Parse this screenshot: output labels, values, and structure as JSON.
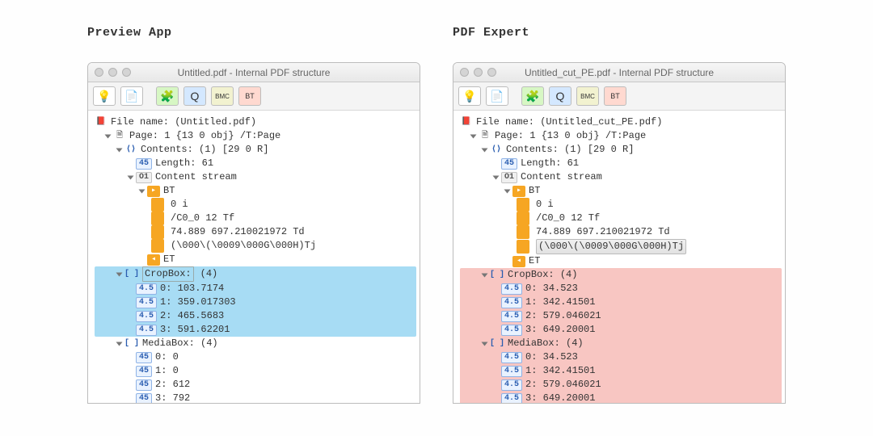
{
  "left": {
    "heading": "Preview App",
    "title": "Untitled.pdf - Internal PDF structure",
    "filename": "File name: (Untitled.pdf)",
    "page": "Page: 1  {13 0 obj}   /T:Page",
    "contents": "Contents:  (1) [29 0 R]",
    "length": "Length:  61",
    "cstream": "Content stream",
    "bt": "BT",
    "l0": "0 i",
    "l1": "/C0_0 12 Tf",
    "l2": "74.889 697.210021972 Td",
    "l3": "(\\000\\(\\0009\\000G\\000H)Tj",
    "et": "ET",
    "crop_label": "CropBox:",
    "crop_count": "(4)",
    "crop": [
      "0:  103.7174",
      "1:  359.017303",
      "2:  465.5683",
      "3:  591.62201"
    ],
    "media_label": "MediaBox:   (4)",
    "media": [
      "0:  0",
      "1:  0",
      "2:  612",
      "3:  792"
    ]
  },
  "right": {
    "heading": "PDF Expert",
    "title": "Untitled_cut_PE.pdf - Internal PDF structure",
    "filename": "File name: (Untitled_cut_PE.pdf)",
    "page": "Page: 1  {13 0 obj}   /T:Page",
    "contents": "Contents:  (1) [29 0 R]",
    "length": "Length:  61",
    "cstream": "Content stream",
    "bt": "BT",
    "l0": "0 i",
    "l1": "/C0_0 12 Tf",
    "l2": "74.889 697.210021972 Td",
    "l3": "(\\000\\(\\0009\\000G\\000H)Tj",
    "et": "ET",
    "crop_label": "CropBox:   (4)",
    "crop": [
      "0:  34.523",
      "1:  342.41501",
      "2:  579.046021",
      "3:  649.20001"
    ],
    "media_label": "MediaBox:   (4)",
    "media": [
      "0:  34.523",
      "1:  342.41501",
      "2:  579.046021",
      "3:  649.20001"
    ]
  },
  "icons": {
    "brackets": "⟨⟩",
    "num": "4.5",
    "bracket": "[ ]",
    "o1": "O1",
    "bt": "▶",
    "et": "◀"
  }
}
